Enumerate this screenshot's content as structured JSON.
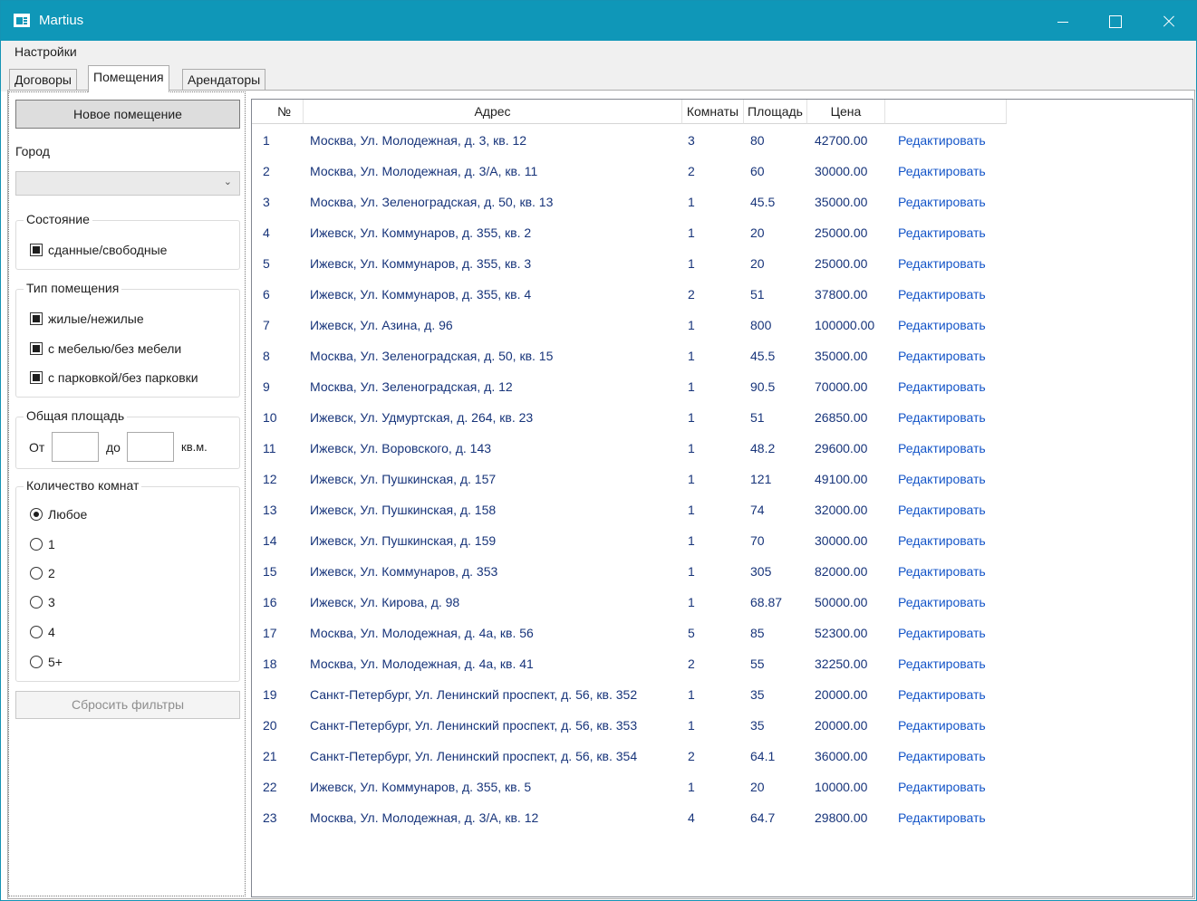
{
  "window": {
    "title": "Martius"
  },
  "menu": {
    "settings": "Настройки"
  },
  "tabs": [
    "Договоры",
    "Помещения",
    "Арендаторы"
  ],
  "filters": {
    "new_button": "Новое помещение",
    "city_label": "Город",
    "city_value": "",
    "state": {
      "title": "Состояние",
      "options": [
        "сданные/свободные"
      ]
    },
    "type": {
      "title": "Тип помещения",
      "options": [
        "жилые/нежилые",
        "с мебелью/без мебели",
        "с парковкой/без парковки"
      ]
    },
    "area": {
      "title": "Общая площадь",
      "from": "От",
      "to": "до",
      "unit": "кв.м.",
      "from_value": "",
      "to_value": ""
    },
    "rooms": {
      "title": "Количество комнат",
      "options": [
        "Любое",
        "1",
        "2",
        "3",
        "4",
        "5+"
      ],
      "selected": "Любое"
    },
    "reset_button": "Сбросить фильтры"
  },
  "table": {
    "columns": [
      "№",
      "Адрес",
      "Комнаты",
      "Площадь",
      "Цена",
      ""
    ],
    "action_label": "Редактировать",
    "rows": [
      [
        "1",
        "Москва, Ул. Молодежная, д. 3, кв. 12",
        "3",
        "80",
        "42700.00"
      ],
      [
        "2",
        "Москва, Ул. Молодежная, д. 3/А, кв. 11",
        "2",
        "60",
        "30000.00"
      ],
      [
        "3",
        "Москва, Ул. Зеленоградская, д. 50, кв. 13",
        "1",
        "45.5",
        "35000.00"
      ],
      [
        "4",
        "Ижевск, Ул. Коммунаров, д. 355, кв. 2",
        "1",
        "20",
        "25000.00"
      ],
      [
        "5",
        "Ижевск, Ул. Коммунаров, д. 355, кв. 3",
        "1",
        "20",
        "25000.00"
      ],
      [
        "6",
        "Ижевск, Ул. Коммунаров, д. 355, кв. 4",
        "2",
        "51",
        "37800.00"
      ],
      [
        "7",
        "Ижевск, Ул. Азина, д. 96",
        "1",
        "800",
        "100000.00"
      ],
      [
        "8",
        "Москва, Ул. Зеленоградская, д. 50, кв. 15",
        "1",
        "45.5",
        "35000.00"
      ],
      [
        "9",
        "Москва, Ул. Зеленоградская, д. 12",
        "1",
        "90.5",
        "70000.00"
      ],
      [
        "10",
        "Ижевск, Ул. Удмуртская, д. 264, кв. 23",
        "1",
        "51",
        "26850.00"
      ],
      [
        "11",
        "Ижевск, Ул. Воровского, д. 143",
        "1",
        "48.2",
        "29600.00"
      ],
      [
        "12",
        "Ижевск, Ул. Пушкинская, д. 157",
        "1",
        "121",
        "49100.00"
      ],
      [
        "13",
        "Ижевск, Ул. Пушкинская, д. 158",
        "1",
        "74",
        "32000.00"
      ],
      [
        "14",
        "Ижевск, Ул. Пушкинская, д. 159",
        "1",
        "70",
        "30000.00"
      ],
      [
        "15",
        "Ижевск, Ул. Коммунаров, д. 353",
        "1",
        "305",
        "82000.00"
      ],
      [
        "16",
        "Ижевск, Ул. Кирова, д. 98",
        "1",
        "68.87",
        "50000.00"
      ],
      [
        "17",
        "Москва, Ул. Молодежная, д. 4а, кв. 56",
        "5",
        "85",
        "52300.00"
      ],
      [
        "18",
        "Москва, Ул. Молодежная, д. 4а, кв. 41",
        "2",
        "55",
        "32250.00"
      ],
      [
        "19",
        "Санкт-Петербург, Ул. Ленинский проспект, д. 56, кв. 352",
        "1",
        "35",
        "20000.00"
      ],
      [
        "20",
        "Санкт-Петербург, Ул. Ленинский проспект, д. 56, кв. 353",
        "1",
        "35",
        "20000.00"
      ],
      [
        "21",
        "Санкт-Петербург, Ул. Ленинский проспект, д. 56, кв. 354",
        "2",
        "64.1",
        "36000.00"
      ],
      [
        "22",
        "Ижевск, Ул. Коммунаров, д. 355, кв. 5",
        "1",
        "20",
        "10000.00"
      ],
      [
        "23",
        "Москва, Ул. Молодежная, д. 3/А, кв. 12",
        "4",
        "64.7",
        "29800.00"
      ]
    ]
  },
  "colors": {
    "titlebar": "#0f97b8",
    "cell_text": "#17347a",
    "link": "#1455c8"
  }
}
